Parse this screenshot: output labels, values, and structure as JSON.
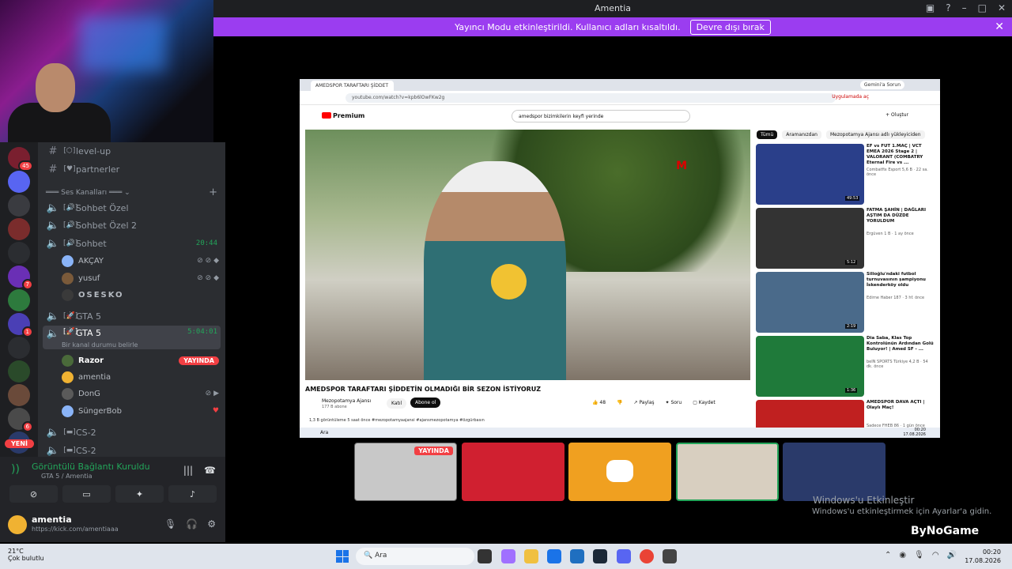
{
  "window": {
    "title": "Amentia"
  },
  "banner": {
    "text": "Yayıncı Modu etkinleştirildi. Kullanıcı adları kısaltıldı.",
    "button": "Devre dışı bırak"
  },
  "servers": [
    {
      "badge": "45",
      "color": "#7a1f2f"
    },
    {
      "badge": "",
      "color": "#5865f2"
    },
    {
      "badge": "",
      "color": "#3a3b40"
    },
    {
      "badge": "",
      "color": "#7a2c2c"
    },
    {
      "badge": "",
      "color": "#2b2d31"
    },
    {
      "badge": "7",
      "color": "#6a2fb5"
    },
    {
      "badge": "",
      "color": "#2d7a3d"
    },
    {
      "badge": "1",
      "color": "#4a3fb5"
    },
    {
      "badge": "",
      "color": "#2b2d31"
    },
    {
      "badge": "",
      "color": "#2a4a2a"
    },
    {
      "badge": "",
      "color": "#6a4a3a"
    },
    {
      "badge": "6",
      "color": "#4a4a4a"
    },
    {
      "badge": "",
      "color": "#2a3a6a"
    }
  ],
  "new_label": "YENİ",
  "channels": {
    "text": [
      {
        "name": "level-up"
      },
      {
        "name": "partnerler"
      }
    ],
    "voice_category": "Ses Kanalları",
    "voice": [
      {
        "name": "Sohbet Özel",
        "time": ""
      },
      {
        "name": "Sohbet Özel 2",
        "time": ""
      },
      {
        "name": "Sohbet",
        "time": "20:44"
      }
    ],
    "sohbet_users": [
      {
        "name": "AKÇAY",
        "color": "#8ab4f8"
      },
      {
        "name": "yusuf",
        "color": "#7a5a3a"
      },
      {
        "name": "OSESKO",
        "color": "#3a3a3a"
      }
    ],
    "gta_channels": [
      {
        "name": "GTA 5",
        "time": ""
      },
      {
        "name": "GTA 5",
        "time": "5:04:01"
      }
    ],
    "gta_status": "Bir kanal durumu belirle",
    "gta_users": [
      {
        "name": "Razor",
        "live": "YAYINDA",
        "color": "#4a6a3a"
      },
      {
        "name": "amentia",
        "live": "",
        "color": "#f0b232"
      },
      {
        "name": "DonG",
        "live": "",
        "color": "#5a5a5a"
      },
      {
        "name": "SüngerBob",
        "live": "",
        "color": "#8ab4f8"
      }
    ],
    "cs_channels": [
      {
        "name": "CS-2"
      },
      {
        "name": "CS-2"
      }
    ]
  },
  "voice_panel": {
    "status": "Görüntülü Bağlantı Kuruldu",
    "channel": "GTA 5 / Amentia"
  },
  "user_panel": {
    "name": "amentia",
    "status": "https://kick.com/amentiaaa"
  },
  "browser": {
    "tab": "AMEDSPOR TARAFTARI ŞİDDET",
    "gemini": "Gemini'a Sorun",
    "url": "youtube.com/watch?v=kpb6lOwFKw2g",
    "update": "Uygulamada aç",
    "yt_logo": "Premium",
    "search": "amedspor bizimkilerin keyfi yerinde",
    "create": "+ Oluştur",
    "video_title": "AMEDSPOR TARAFTARI ŞİDDETİN OLMADIĞI BİR SEZON İSTİYORUZ",
    "channel": "Mezopotamya Ajansı",
    "subs": "177 B abone",
    "join": "Katıl",
    "subscribe": "Abone ol",
    "likes": "48",
    "share": "Paylaş",
    "ask": "Soru",
    "save": "Kaydet",
    "desc": "1,3 B görüntüleme  5 saat önce  #mezopotamyaajansi #ajansmezopotamya #özgürbasın",
    "chips": [
      "Tümü",
      "Aramanızdan",
      "Mezopotamya Ajansı adlı yükleyiciden"
    ],
    "recs": [
      {
        "title": "EF vs FUT 1.MAÇ | VCT EMEA 2026 Stage 2 | VALORANT (COMBATRY Eternal Fire vs ...",
        "meta": "Combatfix Esport\n5,6 B · 22 sa. önce",
        "dur": "49:53",
        "color": "#2a3f8a"
      },
      {
        "title": "FATMA ŞAHİN | DAĞLARI AŞTIM DA DÜZDE YORULDUM",
        "meta": "Ergüven\n1 B · 1 ay önce",
        "dur": "5:12",
        "color": "#333"
      },
      {
        "title": "Silioğlu'ndaki futbol turnuvasının şampiyonu İskenderköy oldu",
        "meta": "Edirne Haber\n187 · 3 hf. önce",
        "dur": "2:19",
        "color": "#4a6a8a"
      },
      {
        "title": "Dia Saba, Klas Top Kontrolünün Ardından Golü Buluyor! | Amed SF - ...",
        "meta": "beIN SPORTS Türkiye\n4,2 B · 54 dk. önce",
        "dur": "1:36",
        "color": "#1f7a3a"
      },
      {
        "title": "AMEDSPOR DAVA AÇTI | Olaylı Maç!",
        "meta": "Sadece FHEB\n86 · 1 gün önce",
        "dur": "",
        "color": "#c02020"
      }
    ],
    "taskbar_search": "Ara",
    "taskbar_time": "00:20",
    "taskbar_date": "17.08.2026"
  },
  "tiles": [
    {
      "label": "YAYINDA",
      "color": "#c8c8c8"
    },
    {
      "label": "",
      "color": "#d02030"
    },
    {
      "label": "",
      "color": "#f0a020"
    },
    {
      "label": "",
      "color": "#d8cfc0"
    },
    {
      "label": "",
      "color": "#2a3a6a"
    }
  ],
  "watermark": {
    "line1": "Windows'u Etkinleştir",
    "line2": "Windows'u etkinleştirmek için Ayarlar'a gidin.",
    "brand": "ByNoGame"
  },
  "taskbar": {
    "temp": "21°C",
    "weather": "Çok bulutlu",
    "search": "Ara",
    "time": "00:20",
    "date": "17.08.2026"
  }
}
